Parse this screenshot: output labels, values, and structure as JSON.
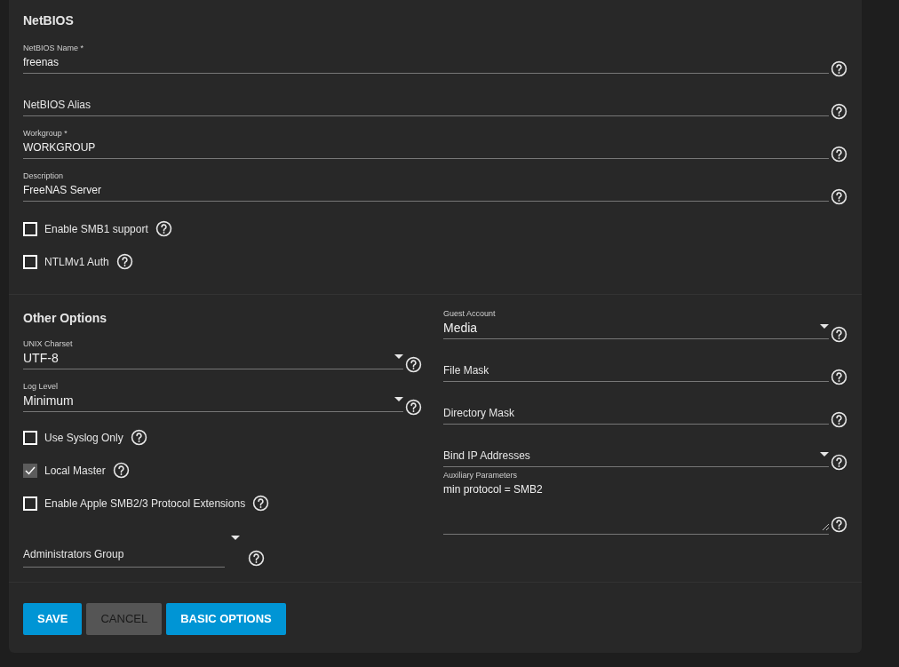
{
  "netbios": {
    "title": "NetBIOS",
    "items": [
      {
        "kind": "text",
        "label": "NetBIOS Name *",
        "value": "freenas"
      },
      {
        "kind": "text",
        "placeholder": "NetBIOS Alias"
      },
      {
        "kind": "text",
        "label": "Workgroup *",
        "value": "WORKGROUP"
      },
      {
        "kind": "text",
        "label": "Description",
        "value": "FreeNAS Server"
      },
      {
        "kind": "checkbox",
        "label": "Enable SMB1 support",
        "checked": false
      },
      {
        "kind": "checkbox",
        "label": "NTLMv1 Auth",
        "checked": false
      }
    ]
  },
  "other_options": {
    "title": "Other Options",
    "left": [
      {
        "kind": "select",
        "label": "UNIX Charset",
        "value": "UTF-8"
      },
      {
        "kind": "select",
        "label": "Log Level",
        "value": "Minimum"
      },
      {
        "kind": "checkbox",
        "label": "Use Syslog Only",
        "checked": false
      },
      {
        "kind": "checkbox",
        "label": "Local Master",
        "checked": true
      },
      {
        "kind": "checkbox",
        "label": "Enable Apple SMB2/3 Protocol Extensions",
        "checked": false
      },
      {
        "kind": "combo",
        "placeholder": "Administrators Group"
      }
    ],
    "right": [
      {
        "kind": "select",
        "label": "Guest Account",
        "value": "Media"
      },
      {
        "kind": "text",
        "placeholder": "File Mask"
      },
      {
        "kind": "text",
        "placeholder": "Directory Mask"
      },
      {
        "kind": "select",
        "placeholder": "Bind IP Addresses"
      },
      {
        "kind": "textarea",
        "label": "Auxiliary Parameters",
        "value": "min protocol = SMB2"
      }
    ]
  },
  "buttons": [
    {
      "label": "SAVE",
      "kind": "primary"
    },
    {
      "label": "CANCEL",
      "kind": "secondary"
    },
    {
      "label": "BASIC OPTIONS",
      "kind": "primary"
    }
  ]
}
